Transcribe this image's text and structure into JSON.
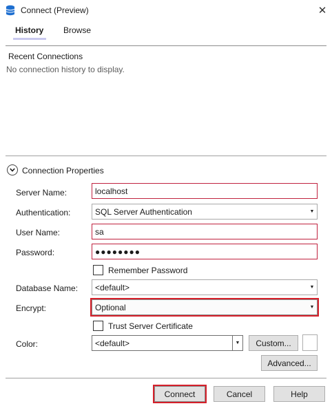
{
  "window": {
    "title": "Connect (Preview)",
    "close_glyph": "✕",
    "icon": "database-icon"
  },
  "tabs": [
    {
      "label": "History",
      "selected": true
    },
    {
      "label": "Browse",
      "selected": false
    }
  ],
  "history": {
    "title": "Recent Connections",
    "empty_message": "No connection history to display."
  },
  "connection": {
    "section_title": "Connection Properties",
    "expanded": true,
    "server_name": {
      "label": "Server Name:",
      "value": "localhost"
    },
    "authentication": {
      "label": "Authentication:",
      "value": "SQL Server Authentication"
    },
    "user_name": {
      "label": "User Name:",
      "value": "sa"
    },
    "password": {
      "label": "Password:",
      "value": "●●●●●●●●"
    },
    "remember_password": {
      "label": "Remember Password",
      "checked": false
    },
    "database_name": {
      "label": "Database Name:",
      "value": "<default>"
    },
    "encrypt": {
      "label": "Encrypt:",
      "value": "Optional"
    },
    "trust_server_certificate": {
      "label": "Trust Server Certificate",
      "checked": false
    },
    "color": {
      "label": "Color:",
      "value": "<default>",
      "custom_button": "Custom...",
      "swatch": "#ffffff"
    },
    "advanced_button": "Advanced..."
  },
  "footer": {
    "connect": "Connect",
    "cancel": "Cancel",
    "help": "Help"
  },
  "colors": {
    "highlight": "#d6202a",
    "invalid_border": "#c0213e",
    "tab_underline": "#c8c8ee",
    "button_face": "#e1e1e1"
  }
}
